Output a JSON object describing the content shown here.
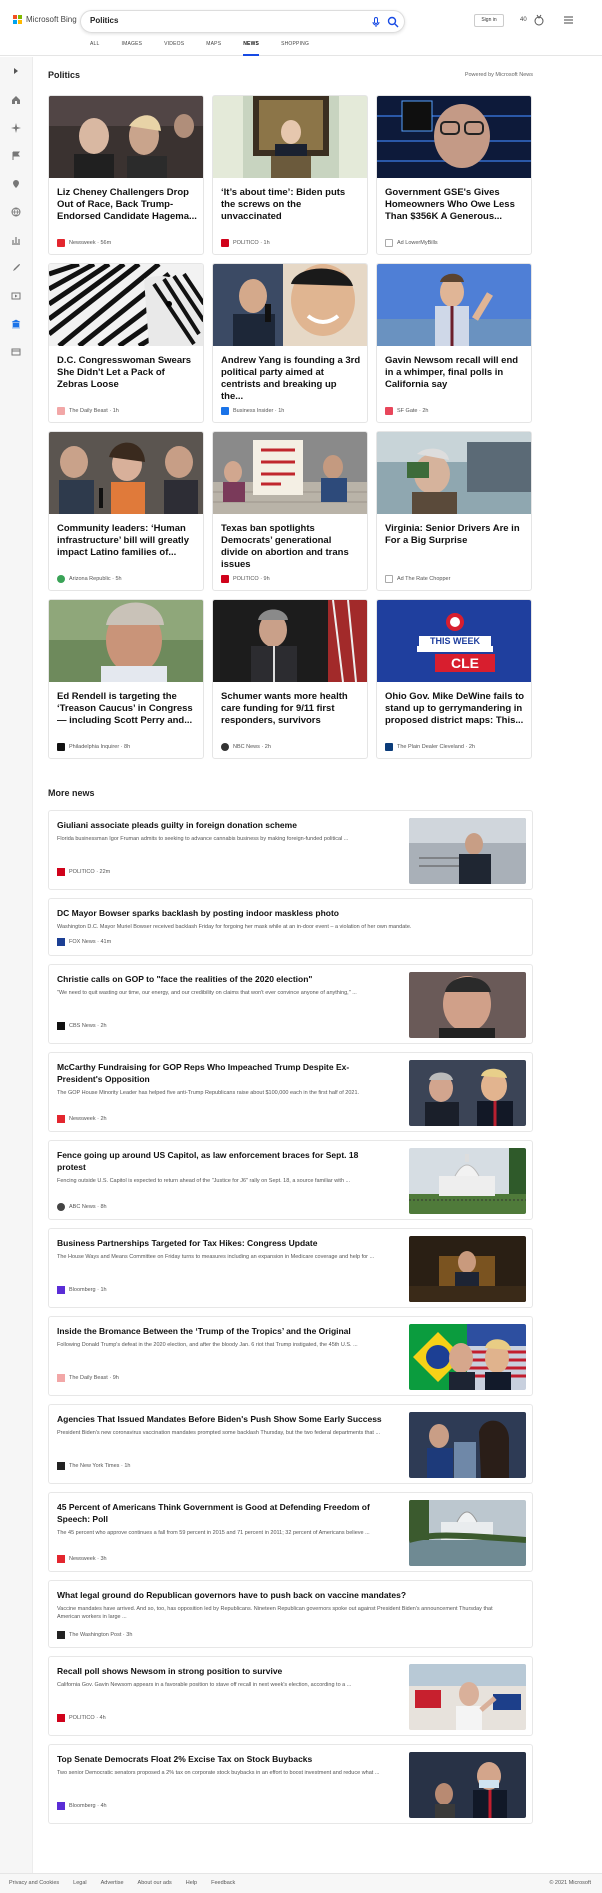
{
  "brand": {
    "name": "Microsoft Bing"
  },
  "search": {
    "query": "Politics"
  },
  "nav": [
    "ALL",
    "IMAGES",
    "VIDEOS",
    "MAPS",
    "NEWS",
    "SHOPPING"
  ],
  "header": {
    "signin": "Sign in",
    "points": "40"
  },
  "section": {
    "title": "Politics",
    "powered": "Powered by Microsoft News"
  },
  "cards": [
    {
      "title": "Liz Cheney Challengers Drop Out of Race, Back Trump-Endorsed Candidate Hagema...",
      "source": "Newsweek · 56m",
      "logo": "#e3262e"
    },
    {
      "title": "‘It’s about time’: Biden puts the screws on the unvaccinated",
      "source": "POLITICO · 1h",
      "logo": "#d0021b"
    },
    {
      "title": "Government GSE's Gives Homeowners Who Owe Less Than $356K A Generous...",
      "source": "Ad LowerMyBills",
      "logo": "#777"
    },
    {
      "title": "D.C. Congresswoman Swears She Didn't Let a Pack of Zebras Loose",
      "source": "The Daily Beast · 1h",
      "logo": "#f2a7a7"
    },
    {
      "title": "Andrew Yang is founding a 3rd political party aimed at centrists and breaking up the...",
      "source": "Business Insider · 1h",
      "logo": "#1a73e8"
    },
    {
      "title": "Gavin Newsom recall will end in a whimper, final polls in California say",
      "source": "SF Gate · 2h",
      "logo": "#e8465b"
    },
    {
      "title": "Community leaders: ‘Human infrastructure’ bill will greatly impact Latino families of...",
      "source": "Arizona Republic · 5h",
      "logo": "#3aa357"
    },
    {
      "title": "Texas ban spotlights Democrats’ generational divide on abortion and trans issues",
      "source": "POLITICO · 9h",
      "logo": "#d0021b"
    },
    {
      "title": "Virginia: Senior Drivers Are in For a Big Surprise",
      "source": "Ad The Rate Chopper",
      "logo": "#777"
    },
    {
      "title": "Ed Rendell is targeting the ‘Treason Caucus’ in Congress — including Scott Perry and...",
      "source": "Philadelphia Inquirer · 8h",
      "logo": "#111"
    },
    {
      "title": "Schumer wants more health care funding for 9/11 first responders, survivors",
      "source": "NBC News · 2h",
      "logo": "#333"
    },
    {
      "title": "Ohio Gov. Mike DeWine fails to stand up to gerrymandering in proposed district maps: This...",
      "source": "The Plain Dealer Cleveland · 2h",
      "logo": "#0b3c7a"
    }
  ],
  "more": {
    "title": "More news"
  },
  "items": [
    {
      "title": "Giuliani associate pleads guilty in foreign donation scheme",
      "snippet": "Florida businessman Igor Fruman admits to seeking to advance cannabis business by making foreign-funded political ...",
      "source": "POLITICO · 22m",
      "logo": "#d0021b"
    },
    {
      "title": "DC Mayor Bowser sparks backlash by posting indoor maskless photo",
      "snippet": "Washington D.C. Mayor Muriel Bowser received backlash Friday for forgoing her mask while at an in-door event – a violation of her own mandate.",
      "source": "FOX News · 41m",
      "logo": "#1c3f94"
    },
    {
      "title": "Christie calls on GOP to \"face the realities of the 2020 election\"",
      "snippet": "\"We need to quit wasting our time, our energy, and our credibility on claims that won't ever convince anyone of anything,\" ...",
      "source": "CBS News · 2h",
      "logo": "#111"
    },
    {
      "title": "McCarthy Fundraising for GOP Reps Who Impeached Trump Despite Ex-President's Opposition",
      "snippet": "The GOP House Minority Leader has helped five anti-Trump Republicans raise about $100,000 each in the first half of 2021.",
      "source": "Newsweek · 2h",
      "logo": "#e3262e"
    },
    {
      "title": "Fence going up around US Capitol, as law enforcement braces for Sept. 18 protest",
      "snippet": "Fencing outside U.S. Capitol is expected to return ahead of the \"Justice for J6\" rally on Sept. 18, a source familiar with ...",
      "source": "ABC News · 8h",
      "logo": "#444"
    },
    {
      "title": "Business Partnerships Targeted for Tax Hikes: Congress Update",
      "snippet": "The House Ways and Means Committee on Friday turns to measures including an expansion in Medicare coverage and help for ...",
      "source": "Bloomberg · 1h",
      "logo": "#5a2dd6"
    },
    {
      "title": "Inside the Bromance Between the ‘Trump of the Tropics’ and the Original",
      "snippet": "Following Donald Trump's defeat in the 2020 election, and after the bloody Jan. 6 riot that Trump instigated, the 45th U.S. ...",
      "source": "The Daily Beast · 9h",
      "logo": "#f2a7a7"
    },
    {
      "title": "Agencies That Issued Mandates Before Biden's Push Show Some Early Success",
      "snippet": "President Biden's new coronavirus vaccination mandates prompted some backlash Thursday, but the two federal departments that ...",
      "source": "The New York Times · 1h",
      "logo": "#222"
    },
    {
      "title": "45 Percent of Americans Think Government is Good at Defending Freedom of Speech: Poll",
      "snippet": "The 45 percent who approve continues a fall from 59 percent in 2015 and 71 percent in 2011; 32 percent of Americans believe ...",
      "source": "Newsweek · 3h",
      "logo": "#e3262e"
    },
    {
      "title": "What legal ground do Republican governors have to push back on vaccine mandates?",
      "snippet": "Vaccine mandates have arrived. And so, too, has opposition led by Republicans. Nineteen Republican governors spoke out against President Biden's announcement Thursday that American workers in large ...",
      "source": "The Washington Post · 3h",
      "logo": "#222"
    },
    {
      "title": "Recall poll shows Newsom in strong position to survive",
      "snippet": "California Gov. Gavin Newsom appears in a favorable position to stave off recall in next week's election, according to a ...",
      "source": "POLITICO · 4h",
      "logo": "#d0021b"
    },
    {
      "title": "Top Senate Democrats Float 2% Excise Tax on Stock Buybacks",
      "snippet": "Two senior Democratic senators proposed a 2% tax on corporate stock buybacks in an effort to boost investment and reduce what ...",
      "source": "Bloomberg · 4h",
      "logo": "#5a2dd6"
    }
  ],
  "footer": {
    "links": [
      "Privacy and Cookies",
      "Legal",
      "Advertise",
      "About our ads",
      "Help",
      "Feedback"
    ],
    "copy": "© 2021 Microsoft"
  },
  "colors": {
    "accent": "#174ae4",
    "rail": "#f6f6f6"
  }
}
